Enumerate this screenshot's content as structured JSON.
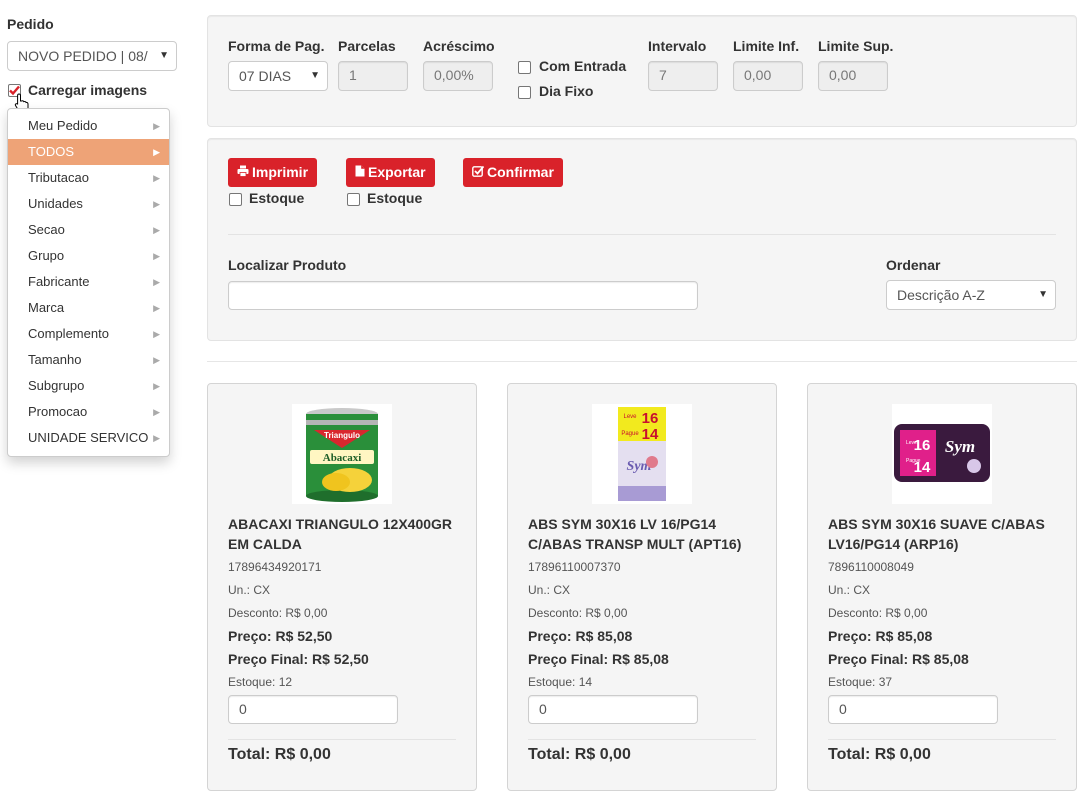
{
  "sidebar": {
    "pedido_label": "Pedido",
    "pedido_value": "NOVO PEDIDO | 08/",
    "carregar_label": "Carregar imagens",
    "menu": [
      {
        "label": "Meu Pedido",
        "active": false
      },
      {
        "label": "TODOS",
        "active": true
      },
      {
        "label": "Tributacao",
        "active": false
      },
      {
        "label": "Unidades",
        "active": false
      },
      {
        "label": "Secao",
        "active": false
      },
      {
        "label": "Grupo",
        "active": false
      },
      {
        "label": "Fabricante",
        "active": false
      },
      {
        "label": "Marca",
        "active": false
      },
      {
        "label": "Complemento",
        "active": false
      },
      {
        "label": "Tamanho",
        "active": false
      },
      {
        "label": "Subgrupo",
        "active": false
      },
      {
        "label": "Promocao",
        "active": false
      },
      {
        "label": "UNIDADE SERVICO",
        "active": false
      }
    ]
  },
  "payment": {
    "forma_label": "Forma de Pag.",
    "forma_value": "07 DIAS",
    "parcelas_label": "Parcelas",
    "parcelas_value": "1",
    "acrescimo_label": "Acréscimo",
    "acrescimo_value": "0,00%",
    "com_entrada_label": "Com Entrada",
    "dia_fixo_label": "Dia Fixo",
    "intervalo_label": "Intervalo",
    "intervalo_value": "7",
    "limite_inf_label": "Limite Inf.",
    "limite_inf_value": "0,00",
    "limite_sup_label": "Limite Sup.",
    "limite_sup_value": "0,00"
  },
  "actions": {
    "imprimir_label": "Imprimir",
    "exportar_label": "Exportar",
    "confirmar_label": "Confirmar",
    "estoque_label": "Estoque",
    "localizar_label": "Localizar Produto",
    "localizar_value": "",
    "ordenar_label": "Ordenar",
    "ordenar_value": "Descrição A-Z"
  },
  "products": [
    {
      "name": "ABACAXI TRIANGULO 12X400GR EM CALDA",
      "code": "17896434920171",
      "unit": "Un.: CX",
      "discount": "Desconto: R$ 0,00",
      "price": "Preço: R$ 52,50",
      "final_price": "Preço Final: R$ 52,50",
      "stock": "Estoque: 12",
      "qty": "0",
      "total": "Total: R$ 0,00",
      "image_icon": "pineapple-can-image"
    },
    {
      "name": "ABS SYM 30X16 LV 16/PG14 C/ABAS TRANSP MULT (APT16)",
      "code": "17896110007370",
      "unit": "Un.: CX",
      "discount": "Desconto: R$ 0,00",
      "price": "Preço: R$ 85,08",
      "final_price": "Preço Final: R$ 85,08",
      "stock": "Estoque: 14",
      "qty": "0",
      "total": "Total: R$ 0,00",
      "image_icon": "sym-pad-package-image"
    },
    {
      "name": "ABS SYM 30X16 SUAVE C/ABAS LV16/PG14 (ARP16)",
      "code": "7896110008049",
      "unit": "Un.: CX",
      "discount": "Desconto: R$ 0,00",
      "price": "Preço: R$ 85,08",
      "final_price": "Preço Final: R$ 85,08",
      "stock": "Estoque: 37",
      "qty": "0",
      "total": "Total: R$ 0,00",
      "image_icon": "sym-pad-dark-package-image"
    }
  ],
  "image_text": {
    "brand1": "Triangulo",
    "product1": "Abacaxi",
    "leve": "Leve",
    "pague": "Pague",
    "num16": "16",
    "num14": "14",
    "brand2": "Sym"
  },
  "colors": {
    "accent_red": "#d9222a",
    "menu_active": "#eea377",
    "panel_bg": "#f5f5f5"
  }
}
